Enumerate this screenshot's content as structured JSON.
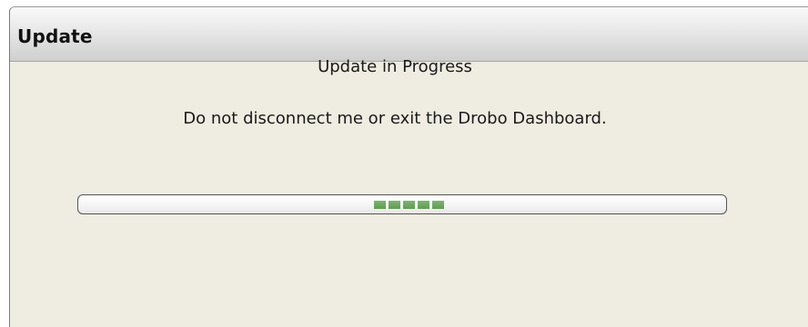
{
  "window": {
    "title": "Update"
  },
  "dialog": {
    "heading": "Update in Progress",
    "message": "Do not disconnect me or exit the Drobo Dashboard."
  },
  "progress": {
    "mode": "indeterminate",
    "segments": 5,
    "color": "#6aa85c"
  },
  "colors": {
    "background": "#efece1",
    "titlebar": "#dcdcdc",
    "text": "#1a1a1a"
  }
}
